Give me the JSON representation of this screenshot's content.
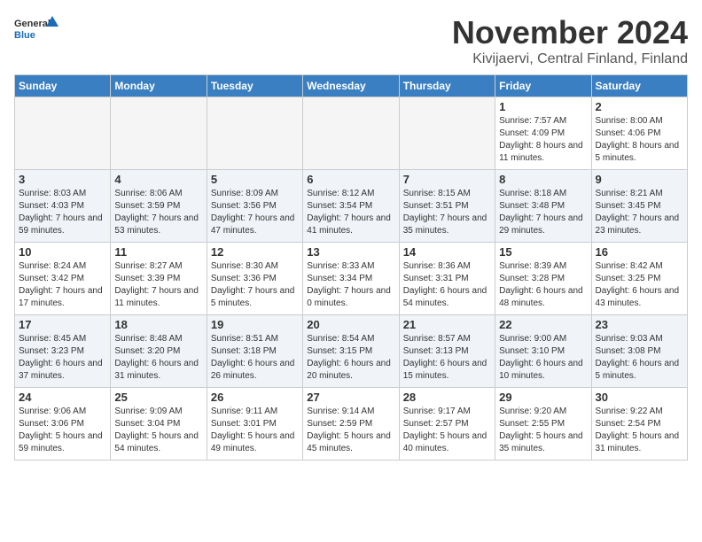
{
  "header": {
    "logo_general": "General",
    "logo_blue": "Blue",
    "month": "November 2024",
    "location": "Kivijaervi, Central Finland, Finland"
  },
  "days_of_week": [
    "Sunday",
    "Monday",
    "Tuesday",
    "Wednesday",
    "Thursday",
    "Friday",
    "Saturday"
  ],
  "weeks": [
    [
      {
        "day": "",
        "empty": true
      },
      {
        "day": "",
        "empty": true
      },
      {
        "day": "",
        "empty": true
      },
      {
        "day": "",
        "empty": true
      },
      {
        "day": "",
        "empty": true
      },
      {
        "day": "1",
        "sunrise": "Sunrise: 7:57 AM",
        "sunset": "Sunset: 4:09 PM",
        "daylight": "Daylight: 8 hours and 11 minutes."
      },
      {
        "day": "2",
        "sunrise": "Sunrise: 8:00 AM",
        "sunset": "Sunset: 4:06 PM",
        "daylight": "Daylight: 8 hours and 5 minutes."
      }
    ],
    [
      {
        "day": "3",
        "sunrise": "Sunrise: 8:03 AM",
        "sunset": "Sunset: 4:03 PM",
        "daylight": "Daylight: 7 hours and 59 minutes."
      },
      {
        "day": "4",
        "sunrise": "Sunrise: 8:06 AM",
        "sunset": "Sunset: 3:59 PM",
        "daylight": "Daylight: 7 hours and 53 minutes."
      },
      {
        "day": "5",
        "sunrise": "Sunrise: 8:09 AM",
        "sunset": "Sunset: 3:56 PM",
        "daylight": "Daylight: 7 hours and 47 minutes."
      },
      {
        "day": "6",
        "sunrise": "Sunrise: 8:12 AM",
        "sunset": "Sunset: 3:54 PM",
        "daylight": "Daylight: 7 hours and 41 minutes."
      },
      {
        "day": "7",
        "sunrise": "Sunrise: 8:15 AM",
        "sunset": "Sunset: 3:51 PM",
        "daylight": "Daylight: 7 hours and 35 minutes."
      },
      {
        "day": "8",
        "sunrise": "Sunrise: 8:18 AM",
        "sunset": "Sunset: 3:48 PM",
        "daylight": "Daylight: 7 hours and 29 minutes."
      },
      {
        "day": "9",
        "sunrise": "Sunrise: 8:21 AM",
        "sunset": "Sunset: 3:45 PM",
        "daylight": "Daylight: 7 hours and 23 minutes."
      }
    ],
    [
      {
        "day": "10",
        "sunrise": "Sunrise: 8:24 AM",
        "sunset": "Sunset: 3:42 PM",
        "daylight": "Daylight: 7 hours and 17 minutes."
      },
      {
        "day": "11",
        "sunrise": "Sunrise: 8:27 AM",
        "sunset": "Sunset: 3:39 PM",
        "daylight": "Daylight: 7 hours and 11 minutes."
      },
      {
        "day": "12",
        "sunrise": "Sunrise: 8:30 AM",
        "sunset": "Sunset: 3:36 PM",
        "daylight": "Daylight: 7 hours and 5 minutes."
      },
      {
        "day": "13",
        "sunrise": "Sunrise: 8:33 AM",
        "sunset": "Sunset: 3:34 PM",
        "daylight": "Daylight: 7 hours and 0 minutes."
      },
      {
        "day": "14",
        "sunrise": "Sunrise: 8:36 AM",
        "sunset": "Sunset: 3:31 PM",
        "daylight": "Daylight: 6 hours and 54 minutes."
      },
      {
        "day": "15",
        "sunrise": "Sunrise: 8:39 AM",
        "sunset": "Sunset: 3:28 PM",
        "daylight": "Daylight: 6 hours and 48 minutes."
      },
      {
        "day": "16",
        "sunrise": "Sunrise: 8:42 AM",
        "sunset": "Sunset: 3:25 PM",
        "daylight": "Daylight: 6 hours and 43 minutes."
      }
    ],
    [
      {
        "day": "17",
        "sunrise": "Sunrise: 8:45 AM",
        "sunset": "Sunset: 3:23 PM",
        "daylight": "Daylight: 6 hours and 37 minutes."
      },
      {
        "day": "18",
        "sunrise": "Sunrise: 8:48 AM",
        "sunset": "Sunset: 3:20 PM",
        "daylight": "Daylight: 6 hours and 31 minutes."
      },
      {
        "day": "19",
        "sunrise": "Sunrise: 8:51 AM",
        "sunset": "Sunset: 3:18 PM",
        "daylight": "Daylight: 6 hours and 26 minutes."
      },
      {
        "day": "20",
        "sunrise": "Sunrise: 8:54 AM",
        "sunset": "Sunset: 3:15 PM",
        "daylight": "Daylight: 6 hours and 20 minutes."
      },
      {
        "day": "21",
        "sunrise": "Sunrise: 8:57 AM",
        "sunset": "Sunset: 3:13 PM",
        "daylight": "Daylight: 6 hours and 15 minutes."
      },
      {
        "day": "22",
        "sunrise": "Sunrise: 9:00 AM",
        "sunset": "Sunset: 3:10 PM",
        "daylight": "Daylight: 6 hours and 10 minutes."
      },
      {
        "day": "23",
        "sunrise": "Sunrise: 9:03 AM",
        "sunset": "Sunset: 3:08 PM",
        "daylight": "Daylight: 6 hours and 5 minutes."
      }
    ],
    [
      {
        "day": "24",
        "sunrise": "Sunrise: 9:06 AM",
        "sunset": "Sunset: 3:06 PM",
        "daylight": "Daylight: 5 hours and 59 minutes."
      },
      {
        "day": "25",
        "sunrise": "Sunrise: 9:09 AM",
        "sunset": "Sunset: 3:04 PM",
        "daylight": "Daylight: 5 hours and 54 minutes."
      },
      {
        "day": "26",
        "sunrise": "Sunrise: 9:11 AM",
        "sunset": "Sunset: 3:01 PM",
        "daylight": "Daylight: 5 hours and 49 minutes."
      },
      {
        "day": "27",
        "sunrise": "Sunrise: 9:14 AM",
        "sunset": "Sunset: 2:59 PM",
        "daylight": "Daylight: 5 hours and 45 minutes."
      },
      {
        "day": "28",
        "sunrise": "Sunrise: 9:17 AM",
        "sunset": "Sunset: 2:57 PM",
        "daylight": "Daylight: 5 hours and 40 minutes."
      },
      {
        "day": "29",
        "sunrise": "Sunrise: 9:20 AM",
        "sunset": "Sunset: 2:55 PM",
        "daylight": "Daylight: 5 hours and 35 minutes."
      },
      {
        "day": "30",
        "sunrise": "Sunrise: 9:22 AM",
        "sunset": "Sunset: 2:54 PM",
        "daylight": "Daylight: 5 hours and 31 minutes."
      }
    ]
  ]
}
